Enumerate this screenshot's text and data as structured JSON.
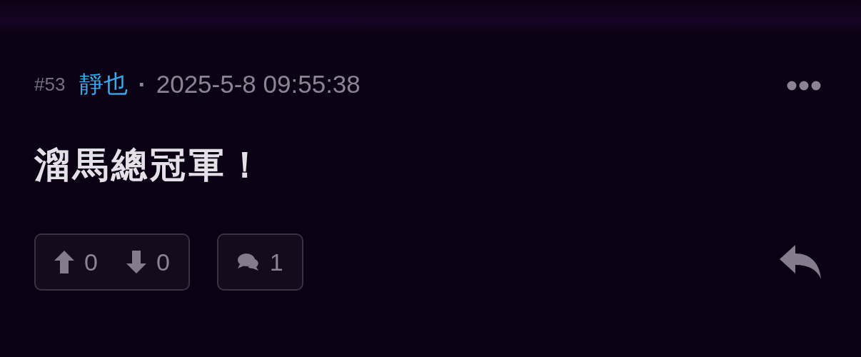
{
  "post": {
    "number": "#53",
    "author": "靜也",
    "separator": "·",
    "timestamp": "2025-5-8 09:55:38",
    "body": "溜馬總冠軍！",
    "votes": {
      "up": "0",
      "down": "0"
    },
    "comments": "1"
  }
}
